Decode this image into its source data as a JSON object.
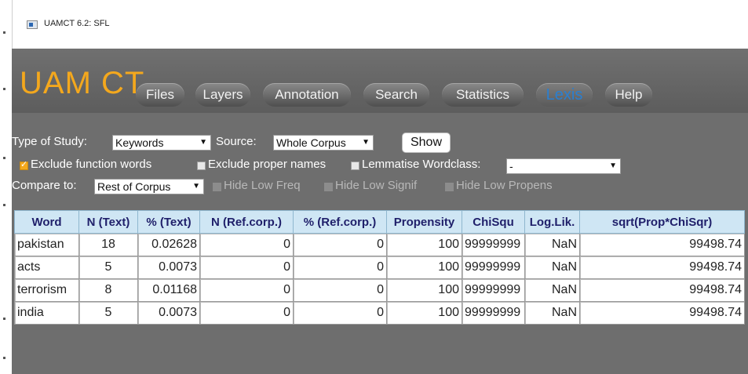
{
  "window": {
    "title": "UAMCT 6.2: SFL"
  },
  "app": {
    "logo": "UAM CT",
    "menu": [
      {
        "label": "Files",
        "active": false
      },
      {
        "label": "Layers",
        "active": false
      },
      {
        "label": "Annotation",
        "active": false
      },
      {
        "label": "Search",
        "active": false
      },
      {
        "label": "Statistics",
        "active": false
      },
      {
        "label": "Lexis",
        "active": true
      },
      {
        "label": "Help",
        "active": false
      }
    ]
  },
  "controls": {
    "type_of_study_label": "Type of Study:",
    "type_of_study_value": "Keywords",
    "source_label": "Source:",
    "source_value": "Whole Corpus",
    "show_label": "Show",
    "exclude_function_words": {
      "label": "Exclude function words",
      "checked": true
    },
    "exclude_proper_names": {
      "label": "Exclude proper names",
      "checked": false
    },
    "lemmatise_wordclass": {
      "label": "Lemmatise Wordclass:",
      "checked": false,
      "value": "-"
    },
    "compare_to_label": "Compare to:",
    "compare_to_value": "Rest of Corpus",
    "hide_low_freq": {
      "label": "Hide Low Freq",
      "checked": false
    },
    "hide_low_signif": {
      "label": "Hide Low Signif",
      "checked": false
    },
    "hide_low_propens": {
      "label": "Hide Low Propens",
      "checked": false
    }
  },
  "table": {
    "columns": [
      "Word",
      "N (Text)",
      "% (Text)",
      "N (Ref.corp.)",
      "% (Ref.corp.)",
      "Propensity",
      "ChiSqu",
      "Log.Lik.",
      "sqrt(Prop*ChiSqr)"
    ],
    "rows": [
      [
        "pakistan",
        "18",
        "0.02628",
        "0",
        "0",
        "100",
        "99999999",
        "NaN",
        "99498.74"
      ],
      [
        "acts",
        "5",
        "0.0073",
        "0",
        "0",
        "100",
        "99999999",
        "NaN",
        "99498.74"
      ],
      [
        "terrorism",
        "8",
        "0.01168",
        "0",
        "0",
        "100",
        "99999999",
        "NaN",
        "99498.74"
      ],
      [
        "india",
        "5",
        "0.0073",
        "0",
        "0",
        "100",
        "99999999",
        "NaN",
        "99498.74"
      ]
    ]
  },
  "colors": {
    "logo": "#f4a81d",
    "active_menu": "#2a7fd0",
    "header_bg": "#cfe6f4",
    "app_bg": "#6e6e6e"
  }
}
